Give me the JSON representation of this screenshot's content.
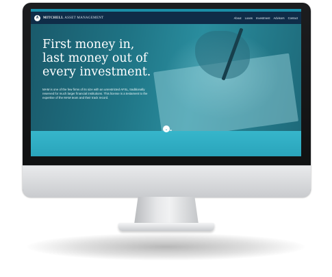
{
  "site": {
    "logo_initial": "A",
    "brand_strong": "MITCHELL",
    "brand_rest": "ASSET MANAGEMENT",
    "nav": [
      "About",
      "Loans",
      "Investment",
      "Advisors",
      "Contact"
    ]
  },
  "hero": {
    "title_line1": "First money in,",
    "title_line2": "last money out of",
    "title_line3": "every investment.",
    "body": "MAM is one of the few firms of its size with an unrestricted AFSL, traditionally reserved for much larger financial institutions. This license is a testament to the expertise of the MAM team and their track record.",
    "scroll_label": "Scroll down",
    "scroll_icon": "chevron-down-icon"
  },
  "colors": {
    "nav_bg": "#0f2c48",
    "accent": "#2fa8bd"
  }
}
